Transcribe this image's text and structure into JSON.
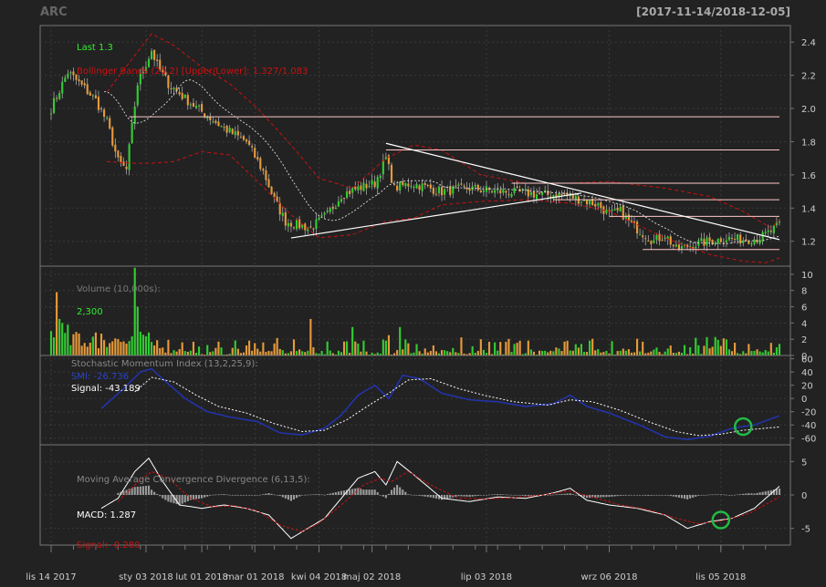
{
  "header": {
    "symbol": "ARC",
    "range": "[2017-11-14/2018-12-05]"
  },
  "colors": {
    "background": "#222222",
    "frame": "#777777",
    "grid": "#3a3a3a",
    "up": "#33cc33",
    "down": "#e69a3a",
    "bollinger": "#cc1111",
    "ma": "#dddddd",
    "trendline": "#ffffff",
    "hline": "#ffc8c8",
    "smi": "#2233aa",
    "signal": "#ffffff",
    "macd_line": "#ffffff",
    "macd_signal": "#cc1111",
    "macd_hist": "#9a9a9a",
    "marker": "#22bb44",
    "last": "#33ee33",
    "smi_label": "#2a44cc"
  },
  "chart_data": [
    {
      "type": "candlestick",
      "panel": "price",
      "ylim": [
        1.05,
        2.5
      ],
      "y_ticks": [
        1.2,
        1.4,
        1.6,
        1.8,
        2.0,
        2.2,
        2.4
      ],
      "legend": {
        "last_label": "Last 1.3",
        "bb_label": "Bollinger Bands (20,2) [Upper/Lower]: 1.327/1.083"
      },
      "x_ticks": [
        {
          "label": "lis 14 2017",
          "index": 0
        },
        {
          "label": "sty 03 2018",
          "index": 34
        },
        {
          "label": "lut 01 2018",
          "index": 54
        },
        {
          "label": "mar 01 2018",
          "index": 73
        },
        {
          "label": "kwi 04 2018",
          "index": 96
        },
        {
          "label": "maj 02 2018",
          "index": 115
        },
        {
          "label": "lip 03 2018",
          "index": 156
        },
        {
          "label": "wrz 06 2018",
          "index": 200
        },
        {
          "label": "lis 05 2018",
          "index": 240
        }
      ],
      "n_points": 262,
      "close_anchors": [
        [
          0,
          2.0
        ],
        [
          6,
          2.22
        ],
        [
          12,
          2.12
        ],
        [
          16,
          2.05
        ],
        [
          20,
          1.92
        ],
        [
          24,
          1.68
        ],
        [
          27,
          1.63
        ],
        [
          31,
          2.15
        ],
        [
          36,
          2.35
        ],
        [
          38,
          2.26
        ],
        [
          42,
          2.15
        ],
        [
          48,
          2.06
        ],
        [
          54,
          1.98
        ],
        [
          62,
          1.88
        ],
        [
          70,
          1.8
        ],
        [
          76,
          1.62
        ],
        [
          80,
          1.45
        ],
        [
          84,
          1.32
        ],
        [
          88,
          1.3
        ],
        [
          93,
          1.28
        ],
        [
          99,
          1.36
        ],
        [
          104,
          1.48
        ],
        [
          110,
          1.52
        ],
        [
          116,
          1.55
        ],
        [
          120,
          1.7
        ],
        [
          123,
          1.52
        ],
        [
          129,
          1.55
        ],
        [
          140,
          1.5
        ],
        [
          150,
          1.52
        ],
        [
          160,
          1.5
        ],
        [
          170,
          1.49
        ],
        [
          176,
          1.48
        ],
        [
          184,
          1.48
        ],
        [
          190,
          1.45
        ],
        [
          196,
          1.42
        ],
        [
          200,
          1.36
        ],
        [
          204,
          1.38
        ],
        [
          208,
          1.3
        ],
        [
          212,
          1.25
        ],
        [
          216,
          1.2
        ],
        [
          220,
          1.24
        ],
        [
          224,
          1.15
        ],
        [
          230,
          1.18
        ],
        [
          236,
          1.2
        ],
        [
          242,
          1.22
        ],
        [
          248,
          1.21
        ],
        [
          254,
          1.22
        ],
        [
          258,
          1.26
        ],
        [
          261,
          1.3
        ]
      ],
      "bollinger_upper_anchors": [
        [
          20,
          2.1
        ],
        [
          30,
          2.32
        ],
        [
          36,
          2.45
        ],
        [
          44,
          2.38
        ],
        [
          54,
          2.25
        ],
        [
          64,
          2.15
        ],
        [
          74,
          2.0
        ],
        [
          86,
          1.78
        ],
        [
          96,
          1.58
        ],
        [
          108,
          1.52
        ],
        [
          120,
          1.7
        ],
        [
          130,
          1.78
        ],
        [
          140,
          1.75
        ],
        [
          154,
          1.6
        ],
        [
          170,
          1.55
        ],
        [
          186,
          1.55
        ],
        [
          200,
          1.56
        ],
        [
          220,
          1.52
        ],
        [
          236,
          1.47
        ],
        [
          248,
          1.38
        ],
        [
          258,
          1.28
        ],
        [
          261,
          1.33
        ]
      ],
      "bollinger_lower_anchors": [
        [
          20,
          1.68
        ],
        [
          30,
          1.67
        ],
        [
          36,
          1.67
        ],
        [
          44,
          1.68
        ],
        [
          54,
          1.74
        ],
        [
          64,
          1.72
        ],
        [
          74,
          1.56
        ],
        [
          86,
          1.36
        ],
        [
          96,
          1.22
        ],
        [
          108,
          1.24
        ],
        [
          120,
          1.32
        ],
        [
          130,
          1.34
        ],
        [
          140,
          1.42
        ],
        [
          154,
          1.44
        ],
        [
          170,
          1.45
        ],
        [
          186,
          1.43
        ],
        [
          200,
          1.38
        ],
        [
          220,
          1.22
        ],
        [
          236,
          1.12
        ],
        [
          248,
          1.08
        ],
        [
          256,
          1.07
        ],
        [
          261,
          1.1
        ]
      ],
      "horizontal_levels": [
        {
          "y": 1.95,
          "from": 28,
          "to": 261
        },
        {
          "y": 1.75,
          "from": 120,
          "to": 261
        },
        {
          "y": 1.55,
          "from": 165,
          "to": 261
        },
        {
          "y": 1.45,
          "from": 180,
          "to": 261
        },
        {
          "y": 1.35,
          "from": 200,
          "to": 261
        },
        {
          "y": 1.15,
          "from": 212,
          "to": 261
        }
      ],
      "trendlines": [
        {
          "x1": 86,
          "y1": 1.22,
          "x2": 190,
          "y2": 1.49
        },
        {
          "x1": 120,
          "y1": 1.79,
          "x2": 261,
          "y2": 1.21
        }
      ]
    },
    {
      "type": "bar",
      "panel": "volume",
      "ylim": [
        0,
        11
      ],
      "y_ticks": [
        0,
        2,
        4,
        6,
        8,
        10
      ],
      "legend": {
        "title": "Volume (10,000s):",
        "last": "2,300"
      },
      "spikes": [
        [
          0,
          3.0
        ],
        [
          2,
          7.8
        ],
        [
          3,
          4.5
        ],
        [
          4,
          4.0
        ],
        [
          6,
          3.8
        ],
        [
          8,
          2.0
        ],
        [
          30,
          10.8
        ],
        [
          31,
          6.0
        ],
        [
          93,
          4.5
        ],
        [
          108,
          3.5
        ],
        [
          121,
          2.5
        ],
        [
          125,
          3.5
        ]
      ]
    },
    {
      "type": "line",
      "panel": "smi",
      "ylim": [
        -70,
        65
      ],
      "y_ticks": [
        -60,
        -40,
        -20,
        0,
        20,
        40,
        60
      ],
      "legend": {
        "title": "Stochastic Momentum Index (13,2,25,9):",
        "smi": "SMI: -26.736",
        "signal": "Signal: -43.189"
      },
      "smi_anchors": [
        [
          18,
          -15
        ],
        [
          26,
          15
        ],
        [
          32,
          40
        ],
        [
          36,
          45
        ],
        [
          42,
          22
        ],
        [
          48,
          0
        ],
        [
          56,
          -20
        ],
        [
          64,
          -28
        ],
        [
          74,
          -35
        ],
        [
          82,
          -52
        ],
        [
          90,
          -55
        ],
        [
          98,
          -45
        ],
        [
          104,
          -25
        ],
        [
          110,
          5
        ],
        [
          116,
          20
        ],
        [
          121,
          0
        ],
        [
          126,
          35
        ],
        [
          132,
          30
        ],
        [
          140,
          8
        ],
        [
          150,
          -2
        ],
        [
          160,
          -5
        ],
        [
          170,
          -12
        ],
        [
          180,
          -8
        ],
        [
          186,
          5
        ],
        [
          192,
          -12
        ],
        [
          200,
          -22
        ],
        [
          212,
          -42
        ],
        [
          220,
          -58
        ],
        [
          228,
          -62
        ],
        [
          236,
          -57
        ],
        [
          244,
          -45
        ],
        [
          252,
          -40
        ],
        [
          261,
          -26
        ]
      ],
      "signal_anchors": [
        [
          30,
          10
        ],
        [
          36,
          32
        ],
        [
          44,
          25
        ],
        [
          52,
          5
        ],
        [
          60,
          -12
        ],
        [
          70,
          -22
        ],
        [
          80,
          -38
        ],
        [
          90,
          -50
        ],
        [
          98,
          -48
        ],
        [
          106,
          -32
        ],
        [
          114,
          -10
        ],
        [
          121,
          8
        ],
        [
          128,
          28
        ],
        [
          136,
          30
        ],
        [
          146,
          15
        ],
        [
          156,
          4
        ],
        [
          166,
          -5
        ],
        [
          178,
          -10
        ],
        [
          186,
          -2
        ],
        [
          194,
          -5
        ],
        [
          204,
          -18
        ],
        [
          214,
          -35
        ],
        [
          224,
          -50
        ],
        [
          232,
          -56
        ],
        [
          240,
          -54
        ],
        [
          248,
          -48
        ],
        [
          261,
          -43
        ]
      ],
      "marker_index": 248
    },
    {
      "type": "line",
      "panel": "macd",
      "ylim": [
        -7.5,
        7.5
      ],
      "y_ticks": [
        -5,
        0,
        5
      ],
      "legend": {
        "title": "Moving Average Convergence Divergence (6,13,5):",
        "macd": "MACD: 1.287",
        "signal": "Signal: -0.280"
      },
      "macd_anchors": [
        [
          18,
          -2.0
        ],
        [
          24,
          -0.5
        ],
        [
          30,
          3.5
        ],
        [
          35,
          5.5
        ],
        [
          40,
          2.0
        ],
        [
          46,
          -1.5
        ],
        [
          54,
          -2.0
        ],
        [
          62,
          -1.5
        ],
        [
          70,
          -2.0
        ],
        [
          78,
          -3.0
        ],
        [
          86,
          -6.5
        ],
        [
          92,
          -5.0
        ],
        [
          98,
          -3.5
        ],
        [
          104,
          -0.5
        ],
        [
          110,
          2.5
        ],
        [
          116,
          3.5
        ],
        [
          120,
          1.5
        ],
        [
          124,
          5.0
        ],
        [
          130,
          3.0
        ],
        [
          140,
          -0.5
        ],
        [
          150,
          -1.0
        ],
        [
          160,
          -0.3
        ],
        [
          170,
          -0.5
        ],
        [
          180,
          0.3
        ],
        [
          186,
          1.0
        ],
        [
          192,
          -0.8
        ],
        [
          200,
          -1.5
        ],
        [
          210,
          -2.0
        ],
        [
          220,
          -3.0
        ],
        [
          228,
          -5.0
        ],
        [
          236,
          -4.0
        ],
        [
          244,
          -3.5
        ],
        [
          252,
          -2.0
        ],
        [
          261,
          1.3
        ]
      ],
      "signal_anchors": [
        [
          24,
          -1.0
        ],
        [
          30,
          1.5
        ],
        [
          36,
          3.5
        ],
        [
          42,
          2.5
        ],
        [
          50,
          -0.5
        ],
        [
          58,
          -1.8
        ],
        [
          66,
          -1.6
        ],
        [
          74,
          -2.4
        ],
        [
          82,
          -4.5
        ],
        [
          90,
          -5.5
        ],
        [
          96,
          -4.2
        ],
        [
          104,
          -1.5
        ],
        [
          112,
          1.5
        ],
        [
          118,
          2.5
        ],
        [
          122,
          2.0
        ],
        [
          128,
          3.5
        ],
        [
          136,
          1.5
        ],
        [
          146,
          -0.5
        ],
        [
          156,
          -0.6
        ],
        [
          166,
          -0.4
        ],
        [
          176,
          0.0
        ],
        [
          186,
          0.6
        ],
        [
          194,
          -0.3
        ],
        [
          204,
          -1.5
        ],
        [
          214,
          -2.2
        ],
        [
          224,
          -3.5
        ],
        [
          232,
          -4.3
        ],
        [
          240,
          -3.9
        ],
        [
          250,
          -2.8
        ],
        [
          261,
          -0.3
        ]
      ],
      "marker_index": 240
    }
  ]
}
